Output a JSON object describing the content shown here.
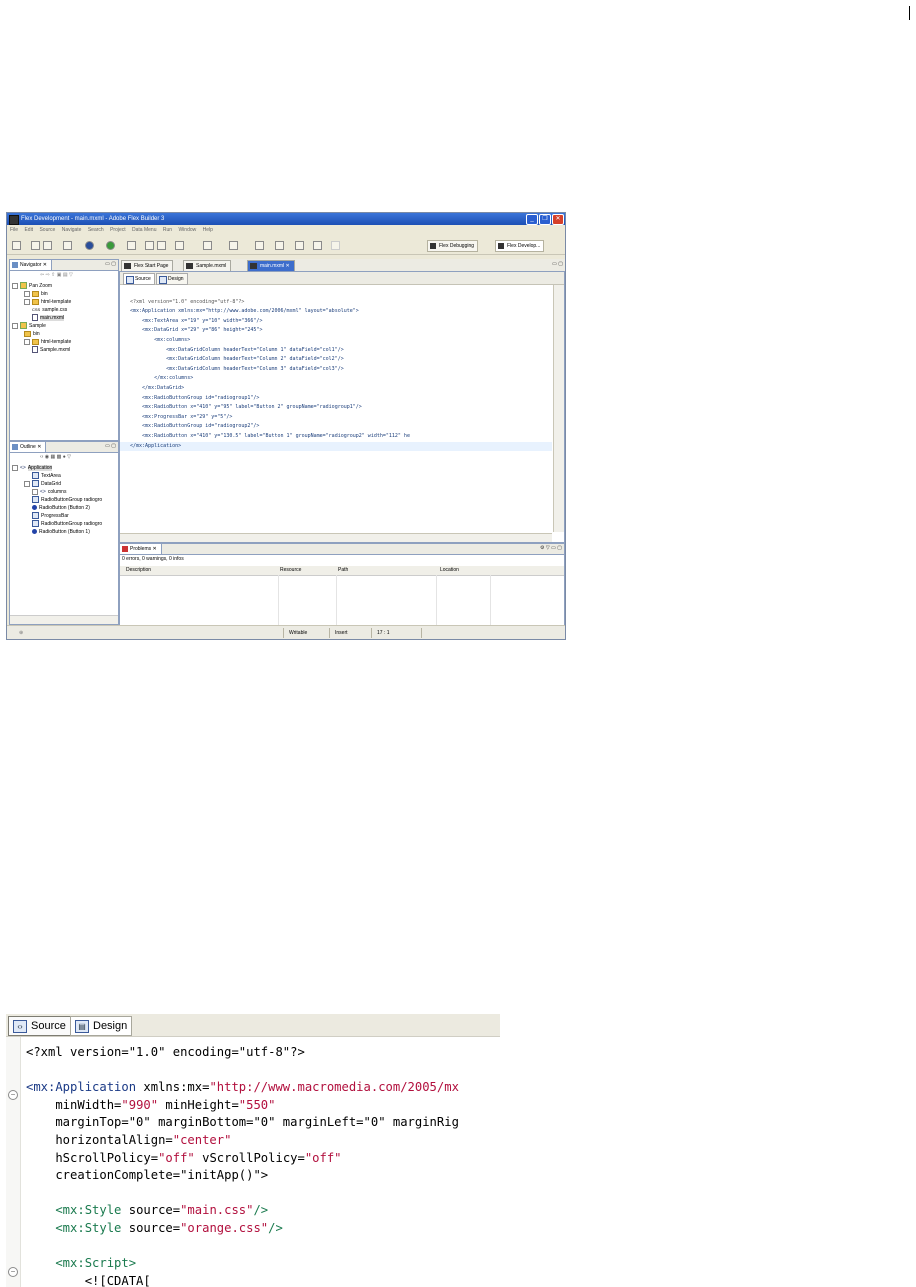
{
  "ide": {
    "window_title": "Flex Development - main.mxml - Adobe Flex Builder 3",
    "window_controls": [
      "_",
      "❐",
      "✕"
    ],
    "menu": [
      "File",
      "Edit",
      "Source",
      "Navigate",
      "Search",
      "Project",
      "Data Menu",
      "Run",
      "Window",
      "Help"
    ],
    "perspectives": [
      "Flex Debugging",
      "Flex Develop..."
    ],
    "navigator": {
      "tab": "Navigator",
      "items": [
        {
          "label": "Pan Zoom",
          "icon": "project-icon"
        },
        {
          "label": "bin",
          "icon": "folder-icon"
        },
        {
          "label": "html-template",
          "icon": "folder-icon"
        },
        {
          "label": "sample.css",
          "icon": "css-file-icon",
          "prefix": "CSS"
        },
        {
          "label": "main.mxml",
          "icon": "mxml-file-icon"
        },
        {
          "label": "Sample",
          "icon": "project-icon"
        },
        {
          "label": "bin",
          "icon": "folder-icon"
        },
        {
          "label": "html-template",
          "icon": "folder-icon"
        },
        {
          "label": "Sample.mxml",
          "icon": "mxml-file-icon"
        }
      ]
    },
    "outline": {
      "tab": "Outline",
      "items": [
        {
          "label": "Application",
          "icon": "tag-icon"
        },
        {
          "label": "TextArea",
          "icon": "component-icon"
        },
        {
          "label": "DataGrid",
          "icon": "component-icon"
        },
        {
          "label": "columns",
          "icon": "tag-icon"
        },
        {
          "label": "RadioButtonGroup radiogro",
          "icon": "component-icon"
        },
        {
          "label": "RadioButton (Button 2)",
          "icon": "radio-icon"
        },
        {
          "label": "ProgressBar",
          "icon": "component-icon"
        },
        {
          "label": "RadioButtonGroup radiogro",
          "icon": "component-icon"
        },
        {
          "label": "RadioButton (Button 1)",
          "icon": "radio-icon"
        }
      ]
    },
    "editor_tabs": [
      "Flex Start Page",
      "Sample.mxml",
      "main.mxml"
    ],
    "source_label": "Source",
    "design_label": "Design",
    "code_lines": [
      "<?xml version=\"1.0\" encoding=\"utf-8\"?>",
      "<mx:Application xmlns:mx=\"http://www.adobe.com/2006/mxml\" layout=\"absolute\">",
      "    <mx:TextArea x=\"19\" y=\"10\" width=\"366\"/>",
      "    <mx:DataGrid x=\"29\" y=\"86\" height=\"245\">",
      "        <mx:columns>",
      "            <mx:DataGridColumn headerText=\"Column 1\" dataField=\"col1\"/>",
      "            <mx:DataGridColumn headerText=\"Column 2\" dataField=\"col2\"/>",
      "            <mx:DataGridColumn headerText=\"Column 3\" dataField=\"col3\"/>",
      "        </mx:columns>",
      "    </mx:DataGrid>",
      "    <mx:RadioButtonGroup id=\"radiogroup1\"/>",
      "    <mx:RadioButton x=\"410\" y=\"95\" label=\"Button 2\" groupName=\"radiogroup1\"/>",
      "    <mx:ProgressBar x=\"29\" y=\"5\"/>",
      "    <mx:RadioButtonGroup id=\"radiogroup2\"/>",
      "    <mx:RadioButton x=\"410\" y=\"130.5\" label=\"Button 1\" groupName=\"radiogroup2\" width=\"112\" he",
      "</mx:Application>"
    ],
    "problems": {
      "tab": "Problems",
      "summary": "0 errors, 0 warnings, 0 infos",
      "columns": [
        "Description",
        "Resource",
        "Path",
        "Location"
      ]
    },
    "status": {
      "writable": "Writable",
      "insert": "Insert",
      "position": "17 : 1"
    }
  },
  "zoom": {
    "source_label": "Source",
    "design_label": "Design",
    "code": {
      "l1": "<?xml version=\"1.0\" encoding=\"utf-8\"?>",
      "app_tag": "<mx:Application",
      "app_attr": " xmlns:mx=",
      "app_val": "\"http://www.macromedia.com/2005/mx",
      "minw_attr": "    minWidth=",
      "minw_val": "\"990\"",
      "minh_attr": " minHeight=",
      "minh_val": "\"550\"",
      "margin_line": "    marginTop=\"0\" marginBottom=\"0\" marginLeft=\"0\" marginRig",
      "ha_attr": "    horizontalAlign=",
      "ha_val": "\"center\"",
      "hs_attr": "    hScrollPolicy=",
      "hs_val": "\"off\"",
      "vs_attr": " vScrollPolicy=",
      "vs_val": "\"off\"",
      "cc_line": "    creationComplete=\"initApp()\">",
      "style1_tag": "    <mx:Style",
      "style1_attr": " source=",
      "style1_val": "\"main.css\"",
      "style_end": "/>",
      "style2_tag": "    <mx:Style",
      "style2_attr": " source=",
      "style2_val": "\"orange.css\"",
      "script_tag": "    <mx:Script>",
      "cdata": "        <![CDATA["
    }
  }
}
